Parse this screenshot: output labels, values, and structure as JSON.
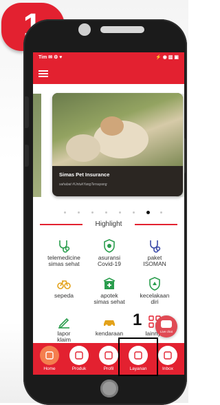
{
  "annotation": {
    "step_badge": "1",
    "target_label": "1"
  },
  "status_bar": {
    "left_text": "Tim ✉ ⚙ ♥",
    "right_text": "⚡ ◉ ▥ ▣"
  },
  "carousel": {
    "card_title": "Simas Pet Insurance",
    "card_subtitle": "sahabat #UntukYangTersayang",
    "peek_right_letter": "S",
    "dots_count": 8,
    "active_dot": 6
  },
  "section": {
    "title": "Highlight"
  },
  "highlights": [
    {
      "label": "telemedicine\nsimas sehat",
      "icon": "stethoscope-icon",
      "color": "#2a9d4d"
    },
    {
      "label": "asuransi\nCovid-19",
      "icon": "virus-shield-icon",
      "color": "#2a9d4d"
    },
    {
      "label": "paket\nISOMAN",
      "icon": "stethoscope-icon",
      "color": "#3b4aa8"
    },
    {
      "label": "sepeda",
      "icon": "bicycle-icon",
      "color": "#e3a21a"
    },
    {
      "label": "apotek\nsimas sehat",
      "icon": "pharmacy-icon",
      "color": "#2a9d4d"
    },
    {
      "label": "kecelakaan\ndiri",
      "icon": "accident-icon",
      "color": "#2a9d4d"
    },
    {
      "label": "lapor\nklaim",
      "icon": "report-pen-icon",
      "color": "#2a9d4d"
    },
    {
      "label": "kendaraan",
      "icon": "car-icon",
      "color": "#e3a21a"
    },
    {
      "label": "lainnya",
      "icon": "grid-more-icon",
      "color": "#e32130"
    }
  ],
  "nav": [
    {
      "label": "Home",
      "icon": "home-icon",
      "active": true
    },
    {
      "label": "Produk",
      "icon": "shopping-bag-icon",
      "active": false
    },
    {
      "label": "Profil",
      "icon": "lock-profile-icon",
      "active": false
    },
    {
      "label": "Layanan",
      "icon": "headset-icon",
      "active": false
    },
    {
      "label": "Inbox",
      "icon": "inbox-icon",
      "active": false
    }
  ],
  "live_chat": {
    "label": "Live chat"
  },
  "colors": {
    "brand_red": "#e32130",
    "active_nav": "#f47e4e"
  }
}
